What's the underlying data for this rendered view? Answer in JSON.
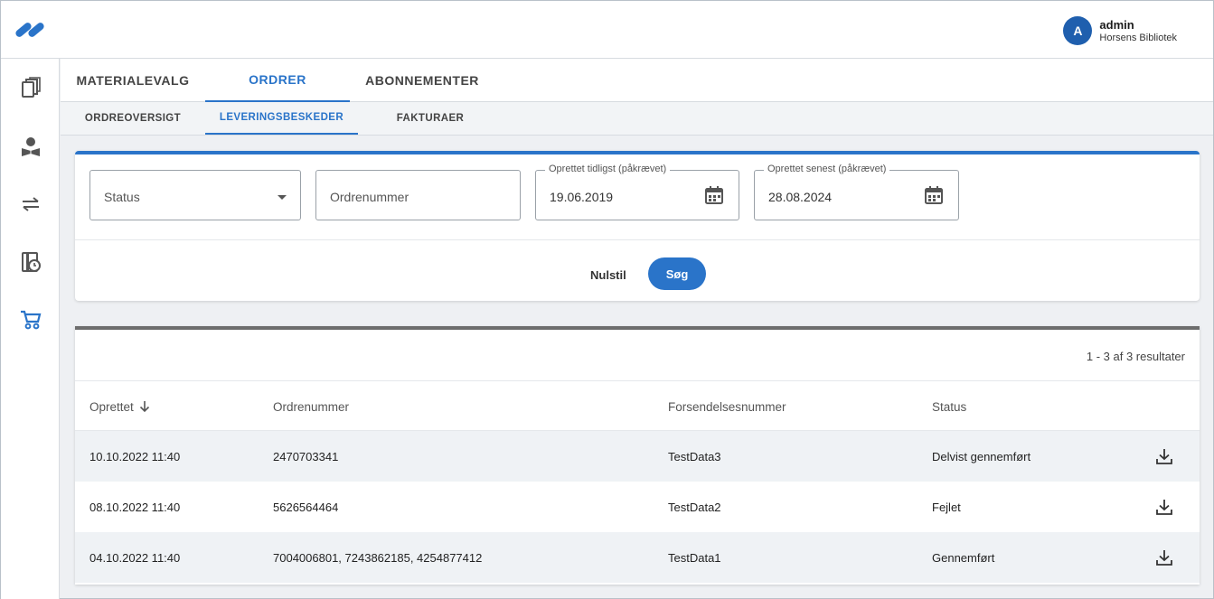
{
  "header": {
    "user_initial": "A",
    "user_name": "admin",
    "user_org": "Horsens Bibliotek"
  },
  "sidenav": {
    "items": [
      {
        "icon": "books-icon"
      },
      {
        "icon": "reader-icon"
      },
      {
        "icon": "transfer-arrows-icon"
      },
      {
        "icon": "book-clock-icon"
      },
      {
        "icon": "cart-icon",
        "active": true
      }
    ]
  },
  "tabs": [
    "MATERIALEVALG",
    "ORDRER",
    "ABONNEMENTER"
  ],
  "subtabs": [
    "ORDREOVERSIGT",
    "LEVERINGSBESKEDER",
    "FAKTURAER"
  ],
  "filters": {
    "status_placeholder": "Status",
    "order_placeholder": "Ordrenummer",
    "from_label": "Oprettet tidligst (påkrævet)",
    "from_value": "19.06.2019",
    "to_label": "Oprettet senest (påkrævet)",
    "to_value": "28.08.2024",
    "reset_label": "Nulstil",
    "search_label": "Søg"
  },
  "results": {
    "count_text": "1 - 3 af 3 resultater",
    "columns": [
      "Oprettet",
      "Ordrenummer",
      "Forsendelsesnummer",
      "Status"
    ],
    "rows": [
      {
        "created": "10.10.2022 11:40",
        "order": "2470703341",
        "shipment": "TestData3",
        "status": "Delvist gennemført"
      },
      {
        "created": "08.10.2022 11:40",
        "order": "5626564464",
        "shipment": "TestData2",
        "status": "Fejlet"
      },
      {
        "created": "04.10.2022 11:40",
        "order": "7004006801, 7243862185, 4254877412",
        "shipment": "TestData1",
        "status": "Gennemført"
      }
    ]
  },
  "colors": {
    "accent": "#2a74c9",
    "avatar": "#1f5fae"
  }
}
